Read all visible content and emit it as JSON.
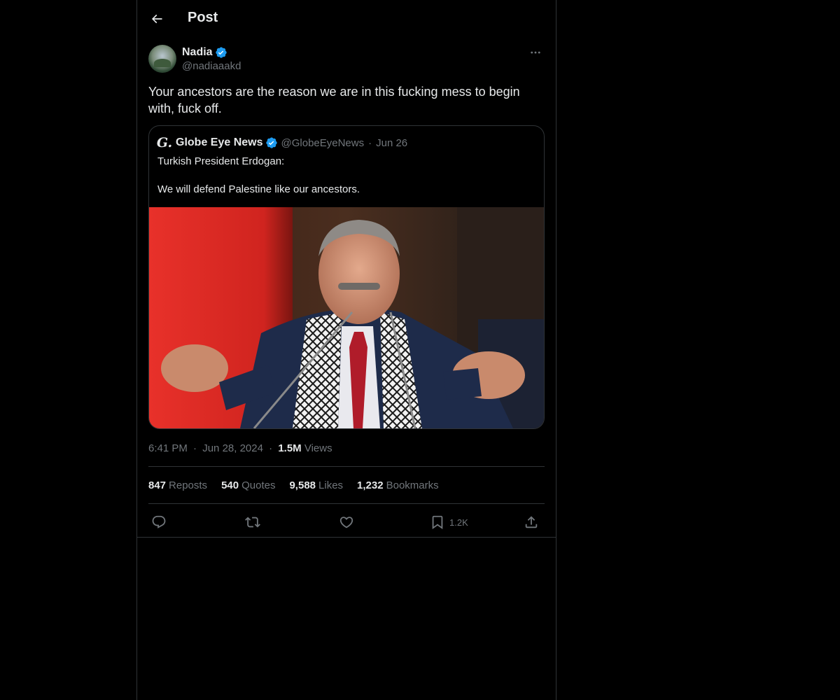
{
  "header": {
    "title": "Post"
  },
  "post": {
    "author": {
      "name": "Nadia",
      "handle": "@nadiaaakd"
    },
    "text": "Your ancestors are the reason we are in this fucking mess to begin with, fuck off.",
    "quoted": {
      "logo_glyph": "G.",
      "name": "Globe Eye News",
      "handle": "@GlobeEyeNews",
      "separator": "·",
      "date": "Jun 26",
      "line1": "Turkish President Erdogan:",
      "line2": "We will defend Palestine like our ancestors."
    },
    "meta": {
      "time": "6:41 PM",
      "date": "Jun 28, 2024",
      "separator": "·",
      "views_count": "1.5M",
      "views_label": "Views"
    },
    "stats": {
      "reposts_count": "847",
      "reposts_label": "Reposts",
      "quotes_count": "540",
      "quotes_label": "Quotes",
      "likes_count": "9,588",
      "likes_label": "Likes",
      "bookmarks_count": "1,232",
      "bookmarks_label": "Bookmarks"
    },
    "actions": {
      "bookmark_count": "1.2K"
    }
  },
  "colors": {
    "background": "#000000",
    "text_primary": "#e7e9ea",
    "text_secondary": "#71767b",
    "border": "#2f3336",
    "verified_blue": "#1d9bf0"
  },
  "icons": {
    "back": "arrow-left-icon",
    "verified": "verified-badge-icon",
    "more": "more-horizontal-icon",
    "reply": "reply-icon",
    "repost": "repost-icon",
    "like": "heart-icon",
    "bookmark": "bookmark-icon",
    "share": "share-icon"
  }
}
